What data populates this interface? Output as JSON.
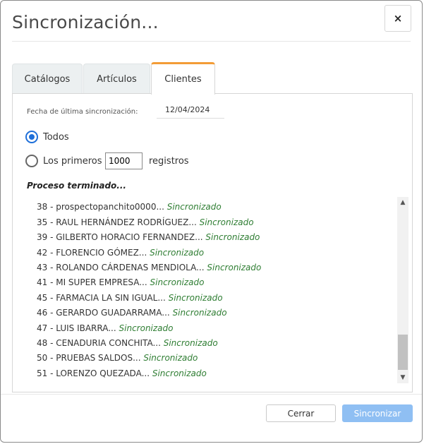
{
  "dialog": {
    "title": "Sincronización...",
    "close_label": "×"
  },
  "tabs": [
    {
      "label": "Catálogos",
      "active": false
    },
    {
      "label": "Artículos",
      "active": false
    },
    {
      "label": "Clientes",
      "active": true
    }
  ],
  "sync": {
    "last_sync_label": "Fecha de última sincronización:",
    "last_sync_value": "12/04/2024"
  },
  "options": {
    "all_label": "Todos",
    "first_label": "Los primeros",
    "first_count": "1000",
    "records_label": "registros",
    "selected": "all"
  },
  "process": {
    "status": "Proceso terminado..."
  },
  "log": [
    {
      "name": "38 - prospectopanchito0000...",
      "status": "Sincronizado"
    },
    {
      "name": "35 - RAUL HERNÁNDEZ RODRÍGUEZ...",
      "status": "Sincronizado"
    },
    {
      "name": "39 - GILBERTO HORACIO FERNANDEZ...",
      "status": "Sincronizado"
    },
    {
      "name": "42 - FLORENCIO GÓMEZ...",
      "status": "Sincronizado"
    },
    {
      "name": "43 - ROLANDO CÁRDENAS MENDIOLA...",
      "status": "Sincronizado"
    },
    {
      "name": "41 - MI SUPER EMPRESA...",
      "status": "Sincronizado"
    },
    {
      "name": "45 - FARMACIA LA SIN IGUAL...",
      "status": "Sincronizado"
    },
    {
      "name": "46 - GERARDO GUADARRAMA...",
      "status": "Sincronizado"
    },
    {
      "name": "47 - LUIS IBARRA...",
      "status": "Sincronizado"
    },
    {
      "name": "48 - CENADURIA CONCHITA...",
      "status": "Sincronizado"
    },
    {
      "name": "50 - PRUEBAS SALDOS...",
      "status": "Sincronizado"
    },
    {
      "name": "51 - LORENZO QUEZADA...",
      "status": "Sincronizado"
    }
  ],
  "footer": {
    "cancel_label": "Cerrar",
    "sync_label": "Sincronizar"
  },
  "colors": {
    "accent_tab": "#f39c36",
    "primary_button": "#8fbff3",
    "status_text": "#2e7d32",
    "radio_selected": "#1e6fd9"
  }
}
